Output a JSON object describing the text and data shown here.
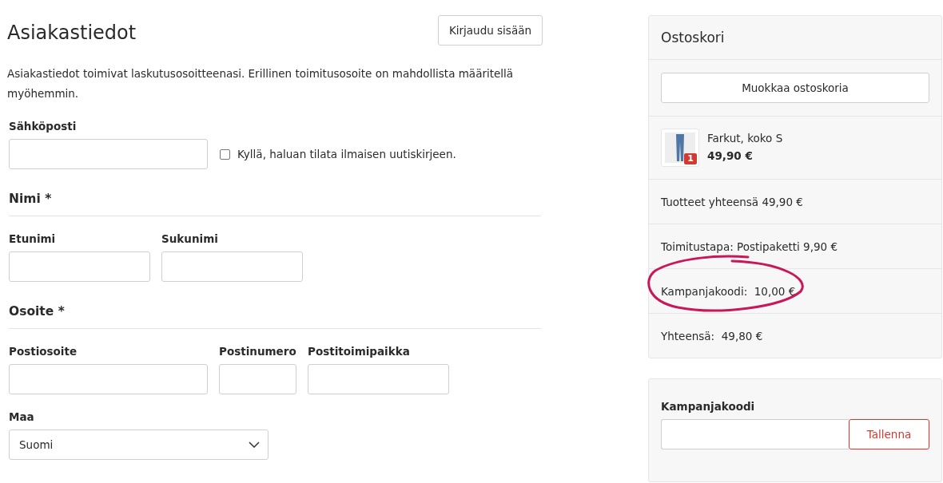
{
  "customer": {
    "title": "Asiakastiedot",
    "login_button": "Kirjaudu sisään",
    "description": "Asiakastiedot toimivat laskutusosoitteenasi. Erillinen toimitusosoite on mahdollista määritellä myöhemmin.",
    "email": {
      "label": "Sähköposti"
    },
    "newsletter": {
      "label": "Kyllä, haluan tilata ilmaisen uutiskirjeen.",
      "checked": false
    },
    "name_section": {
      "heading": "Nimi *",
      "fields": [
        {
          "label": "Etunimi"
        },
        {
          "label": "Sukunimi"
        }
      ]
    },
    "address_section": {
      "heading": "Osoite *",
      "fields": [
        {
          "label": "Postiosoite"
        },
        {
          "label": "Postinumero"
        },
        {
          "label": "Postitoimipaikka"
        }
      ]
    },
    "country": {
      "label": "Maa",
      "value": "Suomi"
    }
  },
  "cart": {
    "title": "Ostoskori",
    "edit_button": "Muokkaa ostoskoria",
    "items": [
      {
        "name": "Farkut, koko S",
        "price": "49,90 €",
        "quantity": "1"
      }
    ],
    "summary": [
      {
        "text": "Tuotteet yhteensä 49,90 €",
        "circled": false
      },
      {
        "text": "Toimitustapa: Postipaketti 9,90 €",
        "circled": false
      },
      {
        "text": "Kampanjakoodi:  10,00 €",
        "circled": true
      },
      {
        "text": "Yhteensä:  49,80 €",
        "circled": false
      }
    ]
  },
  "promo": {
    "label": "Kampanjakoodi",
    "button": "Tallenna"
  }
}
